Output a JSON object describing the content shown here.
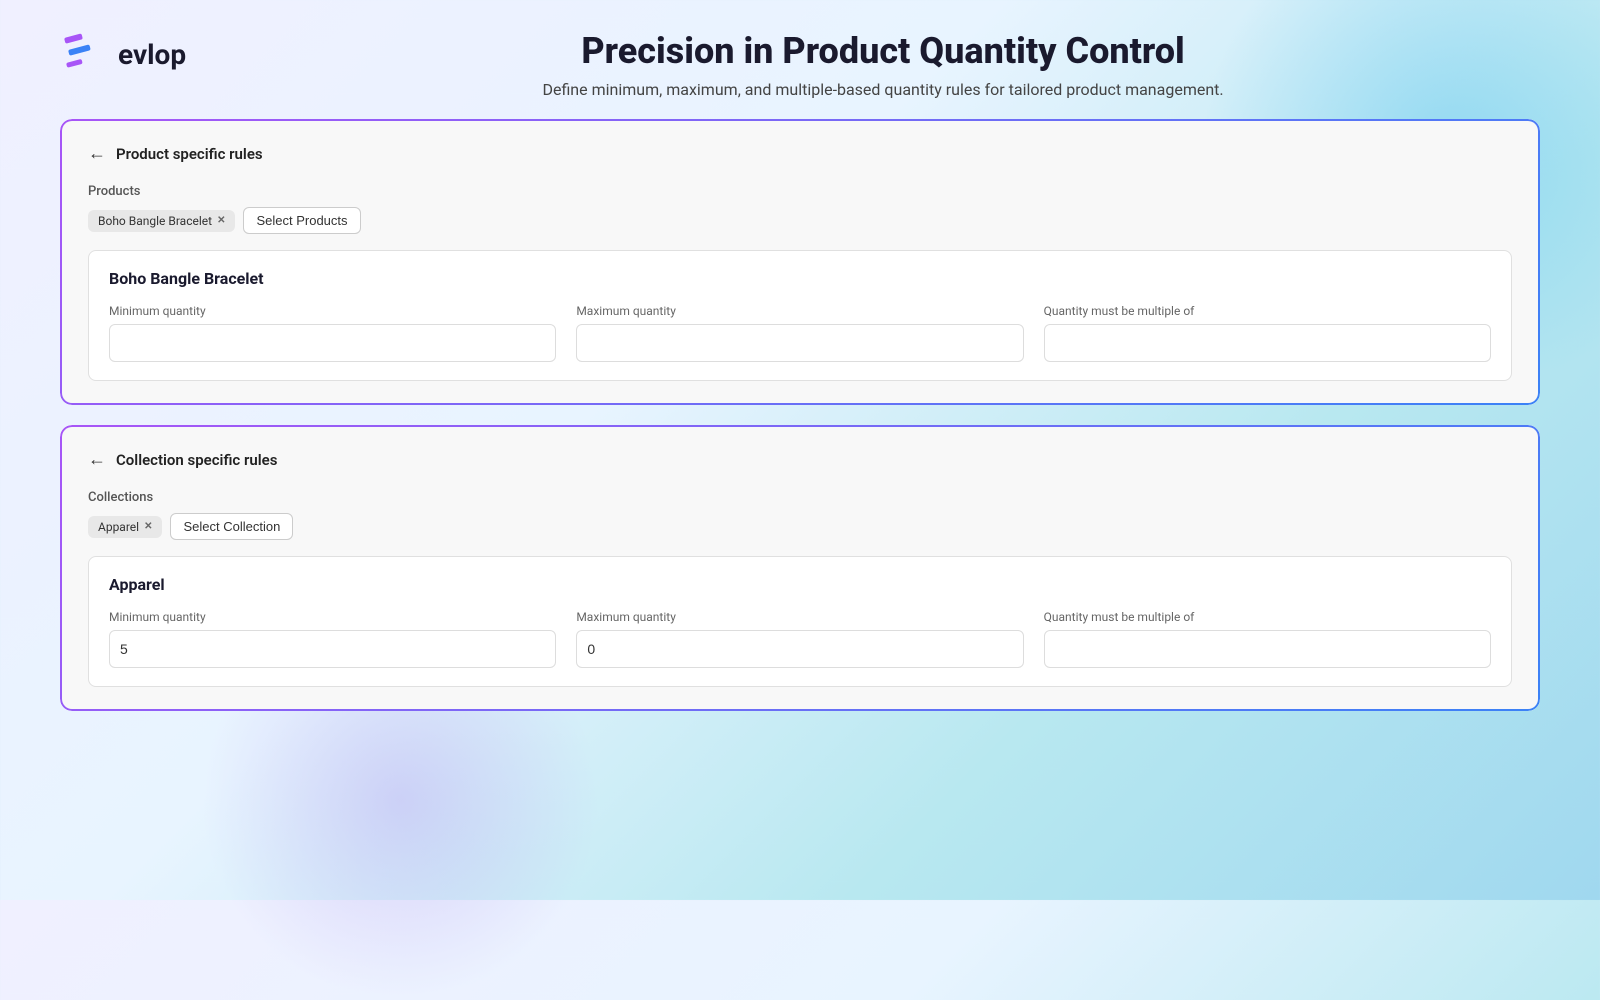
{
  "logo": {
    "text": "evlop"
  },
  "header": {
    "title": "Precision in Product Quantity Control",
    "subtitle": "Define minimum, maximum, and multiple-based quantity rules for tailored product management."
  },
  "product_card": {
    "back_label": "←",
    "title": "Product specific rules",
    "section_label": "Products",
    "tag": "Boho Bangle Bracelet",
    "select_button": "Select Products",
    "product_name": "Boho Bangle Bracelet",
    "fields": {
      "min_label": "Minimum quantity",
      "max_label": "Maximum quantity",
      "multiple_label": "Quantity must be multiple of",
      "min_value": "",
      "max_value": "",
      "multiple_value": ""
    }
  },
  "collection_card": {
    "back_label": "←",
    "title": "Collection specific rules",
    "section_label": "Collections",
    "tag": "Apparel",
    "select_button": "Select Collection",
    "collection_name": "Apparel",
    "fields": {
      "min_label": "Minimum quantity",
      "max_label": "Maximum quantity",
      "multiple_label": "Quantity must be multiple of",
      "min_value": "5",
      "max_value": "0",
      "multiple_value": ""
    }
  }
}
